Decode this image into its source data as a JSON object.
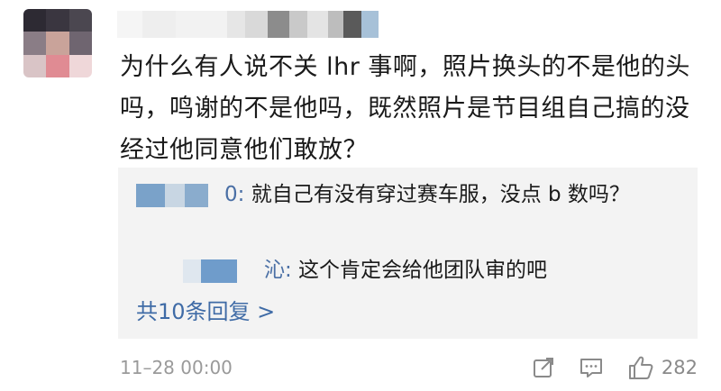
{
  "comment": {
    "text": "为什么有人说不关 lhr 事啊，照片换头的不是他的头吗，鸣谢的不是他吗，既然照片是节目组自己搞的没经过他同意他们敢放？",
    "timestamp": "11–28 00:00",
    "like_count": "282"
  },
  "replies": [
    {
      "name_suffix": "0:",
      "text": " 就自己有没有穿过赛车服，没点 b 数吗？"
    },
    {
      "name_suffix": "沁:",
      "text": " 这个肯定会给他团队审的吧"
    }
  ],
  "more_replies_label": "共10条回复 >",
  "colors": {
    "link": "#3f6ba6",
    "reply_bg": "#f3f3f3",
    "meta": "#9a9a9a"
  },
  "icons": [
    "share-icon",
    "comment-icon",
    "like-icon"
  ]
}
